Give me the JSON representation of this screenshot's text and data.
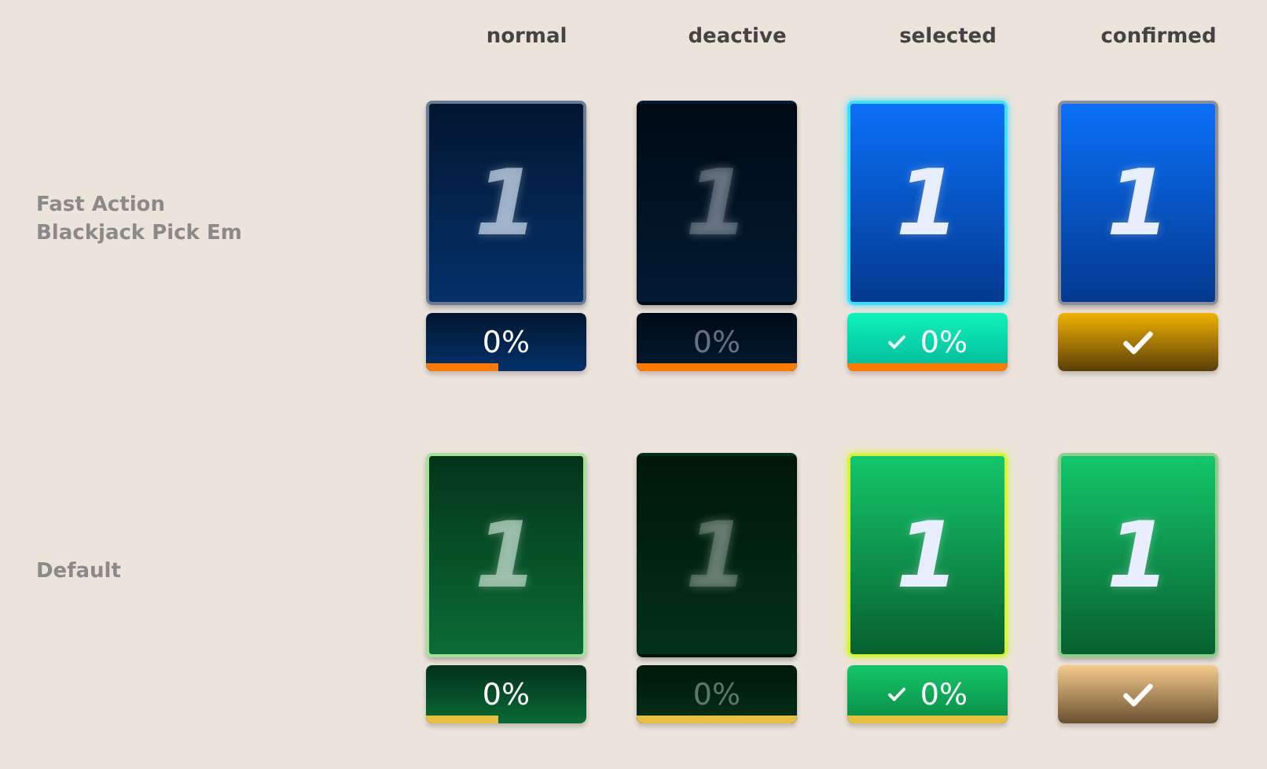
{
  "columns": [
    "normal",
    "deactive",
    "selected",
    "confirmed"
  ],
  "rows": [
    {
      "label": "Fast Action\nBlackjack Pick Em",
      "kind": "blue",
      "cells": [
        {
          "kind": "normal",
          "digit": "1",
          "reading": "0%",
          "level": 0.45
        },
        {
          "kind": "deactive",
          "digit": "1",
          "reading": "0%",
          "level": 1
        },
        {
          "kind": "selected",
          "digit": "1",
          "reading": "0%",
          "level": 1,
          "checked": true
        },
        {
          "kind": "confirmed",
          "digit": "1",
          "checked": true
        }
      ]
    },
    {
      "label": "Default",
      "kind": "green",
      "cells": [
        {
          "kind": "normal",
          "digit": "1",
          "reading": "0%",
          "level": 0.45
        },
        {
          "kind": "deactive",
          "digit": "1",
          "reading": "0%",
          "level": 1
        },
        {
          "kind": "selected",
          "digit": "1",
          "reading": "0%",
          "level": 1,
          "checked": true
        },
        {
          "kind": "confirmed",
          "digit": "1",
          "checked": true
        }
      ]
    }
  ]
}
